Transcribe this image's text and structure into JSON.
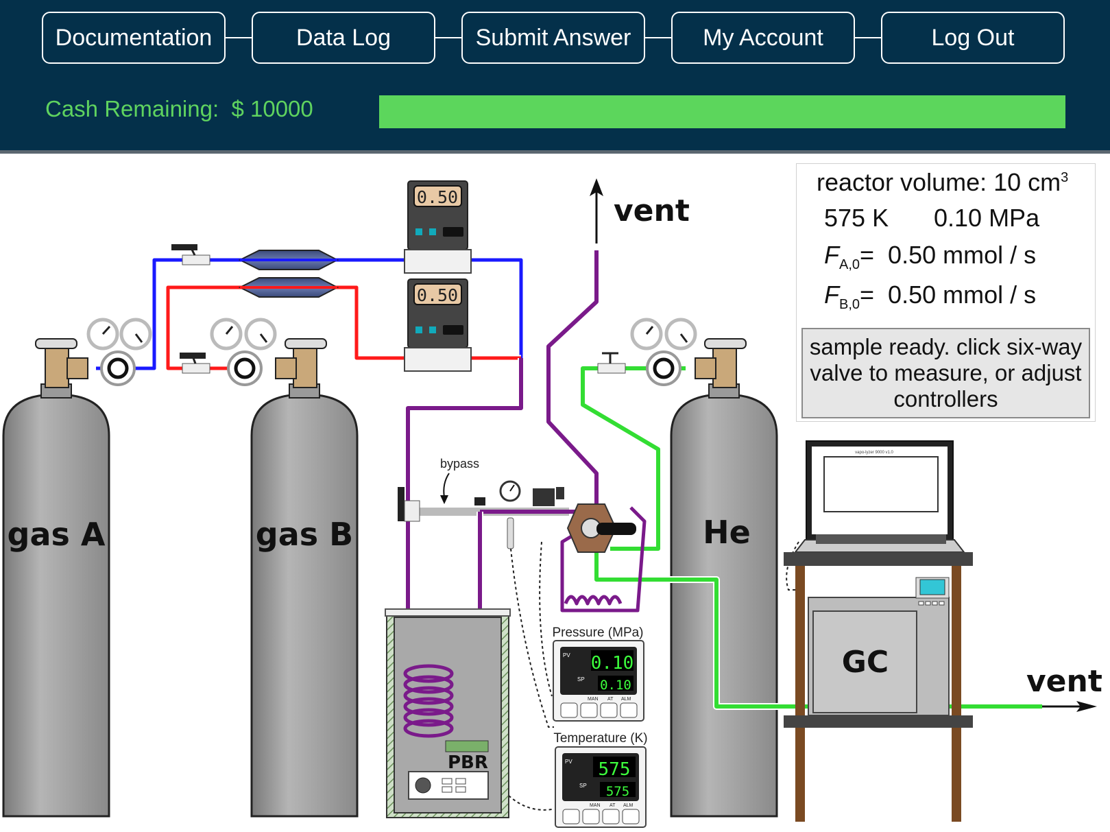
{
  "nav": {
    "documentation": "Documentation",
    "data_log": "Data Log",
    "submit_answer": "Submit Answer",
    "my_account": "My Account",
    "log_out": "Log Out"
  },
  "cash": {
    "label": "Cash Remaining:  $ 10000",
    "bar_fraction": 1.0,
    "bar_color": "#5cd65c"
  },
  "info": {
    "volume_prefix": "reactor volume: 10 cm",
    "volume_exp": "3",
    "temperature": "575 K",
    "pressure": "0.10 MPa",
    "fa_symbol": "F",
    "fa_sub": "A,0",
    "fa_value": "=  0.50 mmol / s",
    "fb_symbol": "F",
    "fb_sub": "B,0",
    "fb_value": "=  0.50 mmol / s",
    "status": "sample ready. click six-way valve to measure, or adjust controllers"
  },
  "scene": {
    "gas_a": "gas A",
    "gas_b": "gas B",
    "he": "He",
    "vent_top": "vent",
    "vent_right": "vent",
    "bypass": "bypass",
    "pbr": "PBR",
    "gc": "GC",
    "mfc_a_display": "0.50",
    "mfc_b_display": "0.50",
    "pressure_title": "Pressure (MPa)",
    "pressure_pv": "0.10",
    "pressure_sp": "0.10",
    "temperature_title": "Temperature (K)",
    "temperature_pv": "575",
    "temperature_sp": "575",
    "pv_tag": "PV",
    "sp_tag": "SP",
    "man_tag": "MAN",
    "at_tag": "AT",
    "alm_tag": "ALM",
    "laptop_title": "vapo-lyzer 9000 v1.0"
  },
  "colors": {
    "header_bg": "#04304a",
    "gas_a_line": "#1a1aff",
    "gas_b_line": "#ff1a1a",
    "mix_line": "#7a1a8a",
    "he_line": "#33dd33",
    "cylinder": "#9a9a9a"
  }
}
